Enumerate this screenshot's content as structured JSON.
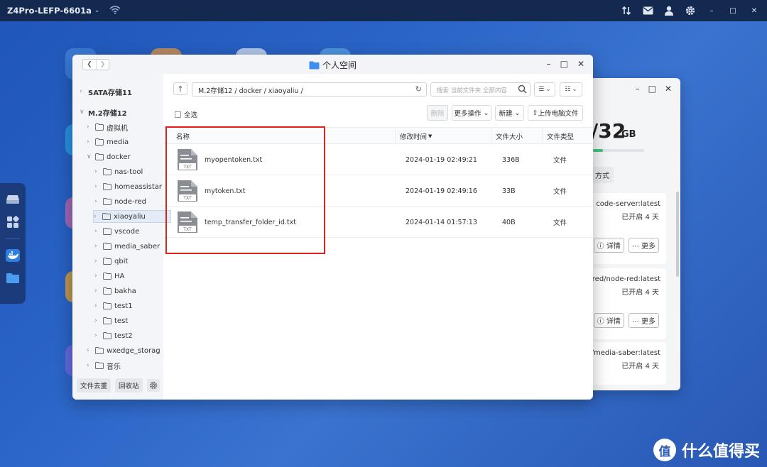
{
  "topbar": {
    "device_name": "Z4Pro-LEFP-6601a",
    "icons": [
      "chevron-down-icon",
      "wifi-icon",
      "transfer-icon",
      "mail-icon",
      "user-icon",
      "settings-icon",
      "minimize-icon",
      "maximize-icon",
      "close-icon"
    ]
  },
  "dock": {
    "icons": [
      "storage-icon",
      "apps-icon",
      "docker-icon",
      "folder-icon"
    ]
  },
  "docker_window": {
    "capacity_value": "/32",
    "capacity_unit": "GB",
    "capacity_fill_fraction": 0.2,
    "mode_button": "方式",
    "cards": [
      {
        "image": "code-server:latest",
        "status": "已开启 4 天",
        "details": "详情",
        "more": "更多"
      },
      {
        "image": "lered/node-red:latest",
        "status": "已开启 4 天",
        "details": "详情",
        "more": "更多"
      },
      {
        "image": "m/media-saber:latest",
        "status": "已开启 4 天"
      }
    ]
  },
  "file_window": {
    "title": "个人空间",
    "sidebar": {
      "tree": [
        {
          "label": "SATA存储11",
          "bold": true,
          "level": 0,
          "expanded": false
        },
        {
          "label": "M.2存储12",
          "bold": true,
          "level": 0,
          "expanded": true
        },
        {
          "label": "虚拟机",
          "level": 1,
          "expanded": false
        },
        {
          "label": "media",
          "level": 1,
          "expanded": false
        },
        {
          "label": "docker",
          "level": 1,
          "expanded": true
        },
        {
          "label": "nas-tool",
          "level": 2,
          "expanded": false
        },
        {
          "label": "homeassistar",
          "level": 2,
          "expanded": false
        },
        {
          "label": "node-red",
          "level": 2,
          "expanded": false
        },
        {
          "label": "xiaoyaliu",
          "level": 2,
          "expanded": false,
          "selected": true
        },
        {
          "label": "vscode",
          "level": 2,
          "expanded": false
        },
        {
          "label": "media_saber",
          "level": 2,
          "expanded": false
        },
        {
          "label": "qbit",
          "level": 2,
          "expanded": false
        },
        {
          "label": "HA",
          "level": 2,
          "expanded": false
        },
        {
          "label": "bakha",
          "level": 2,
          "expanded": false
        },
        {
          "label": "test1",
          "level": 2,
          "expanded": false
        },
        {
          "label": "test",
          "level": 2,
          "expanded": false
        },
        {
          "label": "test2",
          "level": 2,
          "expanded": false
        },
        {
          "label": "wxedge_storag",
          "level": 1,
          "expanded": false
        },
        {
          "label": "音乐",
          "level": 1,
          "expanded": false
        }
      ],
      "footer": {
        "dedupe": "文件去重",
        "recycle": "回收站"
      }
    },
    "toolbar": {
      "path": "M.2存储12 / docker / xiaoyaliu /",
      "search_placeholder": "搜索 当前文件夹 全部内容",
      "select_all": "全选",
      "delete": "删除",
      "more_ops": "更多操作",
      "new": "新建",
      "upload": "上传电脑文件"
    },
    "table": {
      "headers": {
        "name": "名称",
        "modified": "修改时间",
        "size": "文件大小",
        "type": "文件类型"
      },
      "rows": [
        {
          "name": "myopentoken.txt",
          "modified": "2024-01-19 02:49:21",
          "size": "336B",
          "type": "文件",
          "badge": "TXT"
        },
        {
          "name": "mytoken.txt",
          "modified": "2024-01-19 02:49:16",
          "size": "33B",
          "type": "文件",
          "badge": "TXT"
        },
        {
          "name": "temp_transfer_folder_id.txt",
          "modified": "2024-01-14 01:57:13",
          "size": "40B",
          "type": "文件",
          "badge": "TXT"
        }
      ]
    }
  },
  "watermark": {
    "logo": "值",
    "text": "什么值得买"
  }
}
